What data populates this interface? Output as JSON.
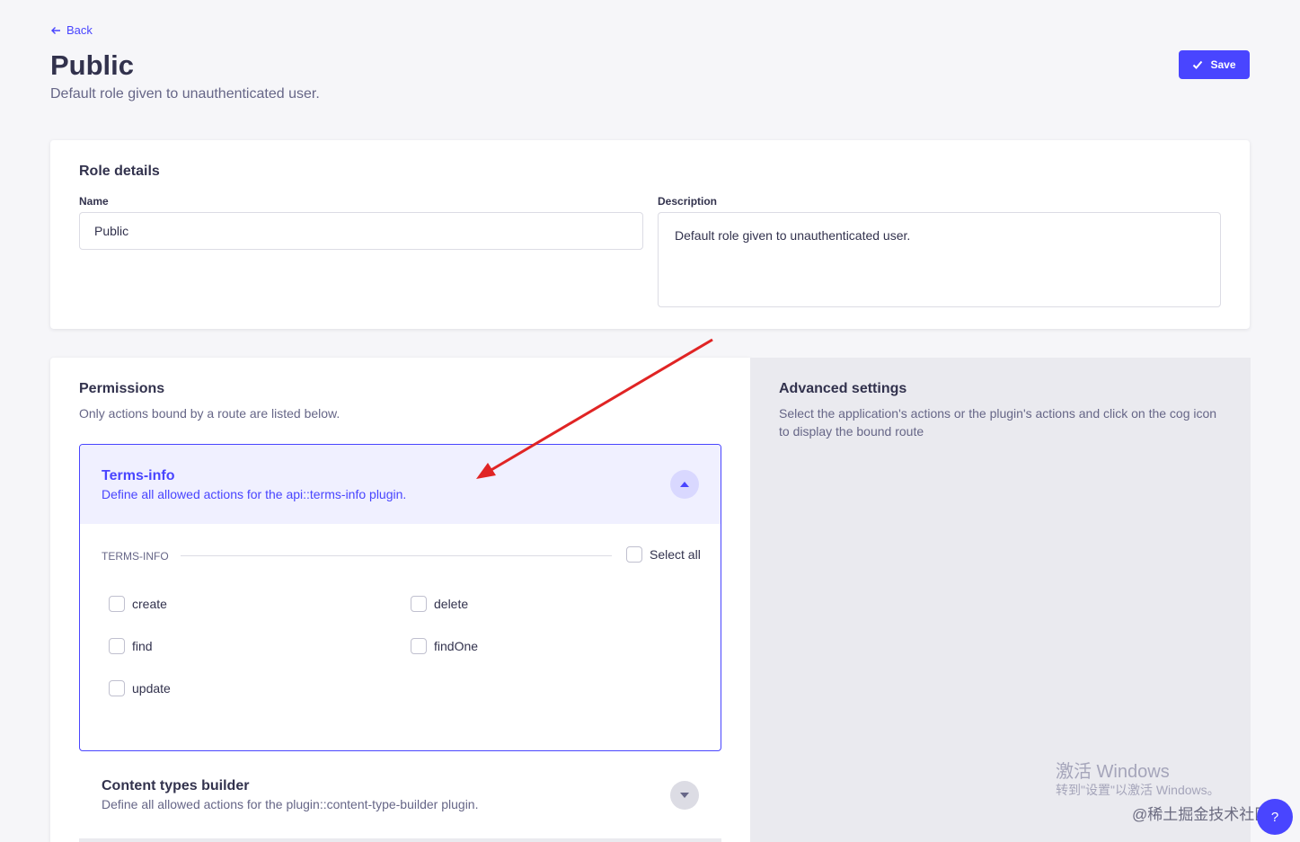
{
  "header": {
    "back_label": "Back",
    "title": "Public",
    "subtitle": "Default role given to unauthenticated user.",
    "save_label": "Save"
  },
  "role_details": {
    "section_title": "Role details",
    "name_label": "Name",
    "name_value": "Public",
    "description_label": "Description",
    "description_value": "Default role given to unauthenticated user."
  },
  "permissions": {
    "title": "Permissions",
    "subtitle": "Only actions bound by a route are listed below.",
    "accordion": {
      "title": "Terms-info",
      "description": "Define all allowed actions for the api::terms-info plugin.",
      "group_label": "TERMS-INFO",
      "select_all_label": "Select all",
      "actions": [
        "create",
        "delete",
        "find",
        "findOne",
        "update"
      ]
    },
    "content_types_builder": {
      "title": "Content types builder",
      "description": "Define all allowed actions for the plugin::content-type-builder plugin."
    }
  },
  "advanced": {
    "title": "Advanced settings",
    "description": "Select the application's actions or the plugin's actions and click on the cog icon to display the bound route"
  },
  "watermark": {
    "line1": "激活 Windows",
    "line2": "转到\"设置\"以激活 Windows。",
    "line3": "@稀土掘金技术社区"
  },
  "help_label": "?",
  "colors": {
    "primary": "#4945ff",
    "annotation_arrow": "#e02424"
  }
}
